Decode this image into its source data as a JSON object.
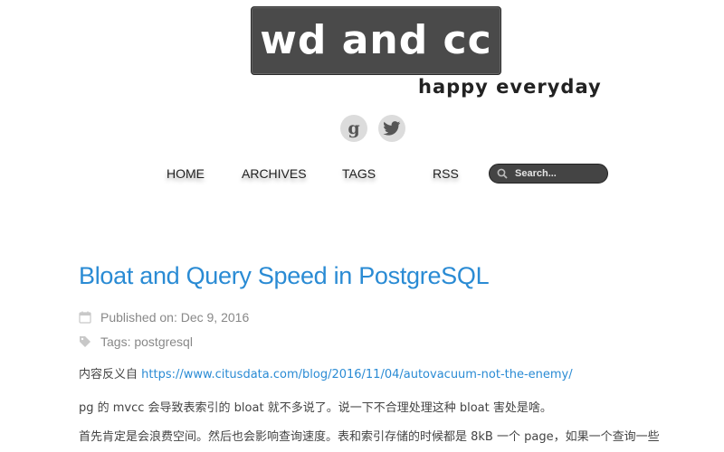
{
  "header": {
    "logo_text": "wd and cc",
    "tagline": "happy everyday"
  },
  "social": [
    {
      "label": "g"
    }
  ],
  "nav": {
    "home": "HOME",
    "archives": "ARCHIVES",
    "tags": "TAGS",
    "rss": "RSS"
  },
  "search": {
    "placeholder": "Search..."
  },
  "post": {
    "title": "Bloat and Query Speed in PostgreSQL",
    "published": "Published on: Dec 9, 2016",
    "tags": "Tags: postgresql",
    "p1_prefix": "内容反义自 ",
    "p1_link": "https://www.citusdata.com/blog/2016/11/04/autovacuum-not-the-enemy/",
    "p2": "pg 的 mvcc 会导致表索引的 bloat 就不多说了。说一下不合理处理这种 bloat 害处是啥。",
    "p3": "首先肯定是会浪费空间。然后也会影响查询速度。表和索引存储的时候都是 8kB 一个 page，如果一个查询一些"
  },
  "colors": {
    "accent": "#2a8bd4",
    "logo_bg": "#4a4a4a",
    "search_bg": "#444444"
  }
}
